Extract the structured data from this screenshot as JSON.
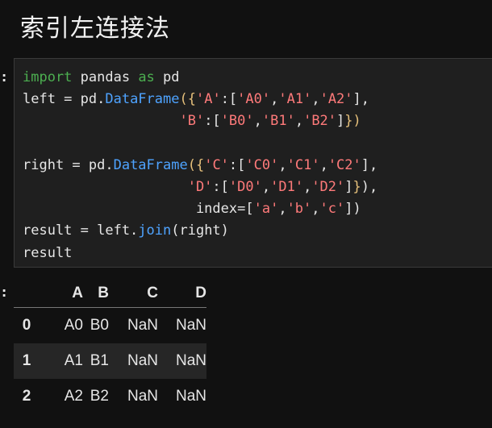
{
  "section_title": "索引左连接法",
  "prompts": {
    "input": ":",
    "output": ":"
  },
  "code": {
    "l1": {
      "kw_import": "import",
      "t1": " pandas ",
      "kw_as": "as",
      "t2": " pd"
    },
    "l2": {
      "t1": "left = pd.",
      "fn": "DataFrame",
      "b1": "({",
      "s1": "'A'",
      "t2": ":[",
      "s2": "'A0'",
      "c1": ",",
      "s3": "'A1'",
      "c2": ",",
      "s4": "'A2'",
      "t3": "],"
    },
    "l3": {
      "indent": "                   ",
      "s1": "'B'",
      "t1": ":[",
      "s2": "'B0'",
      "c1": ",",
      "s3": "'B1'",
      "c2": ",",
      "s4": "'B2'",
      "t2": "]",
      "b1": "})"
    },
    "l5": {
      "t1": "right = pd.",
      "fn": "DataFrame",
      "b1": "({",
      "s1": "'C'",
      "t2": ":[",
      "s2": "'C0'",
      "c1": ",",
      "s3": "'C1'",
      "c2": ",",
      "s4": "'C2'",
      "t3": "],"
    },
    "l6": {
      "indent": "                    ",
      "s1": "'D'",
      "t1": ":[",
      "s2": "'D0'",
      "c1": ",",
      "s3": "'D1'",
      "c2": ",",
      "s4": "'D2'",
      "t2": "]",
      "b1": "}",
      "t3": "),"
    },
    "l7": {
      "indent": "                     ",
      "t1": "index=[",
      "s1": "'a'",
      "c1": ",",
      "s2": "'b'",
      "c2": ",",
      "s3": "'c'",
      "t2": "]",
      "b1": ")"
    },
    "l8": {
      "t1": "result = left.",
      "fn": "join",
      "t2": "(right)"
    },
    "l9": {
      "t1": "result"
    }
  },
  "table": {
    "columns": [
      "A",
      "B",
      "C",
      "D"
    ],
    "rows": [
      {
        "index": "0",
        "A": "A0",
        "B": "B0",
        "C": "NaN",
        "D": "NaN"
      },
      {
        "index": "1",
        "A": "A1",
        "B": "B1",
        "C": "NaN",
        "D": "NaN"
      },
      {
        "index": "2",
        "A": "A2",
        "B": "B2",
        "C": "NaN",
        "D": "NaN"
      }
    ]
  }
}
